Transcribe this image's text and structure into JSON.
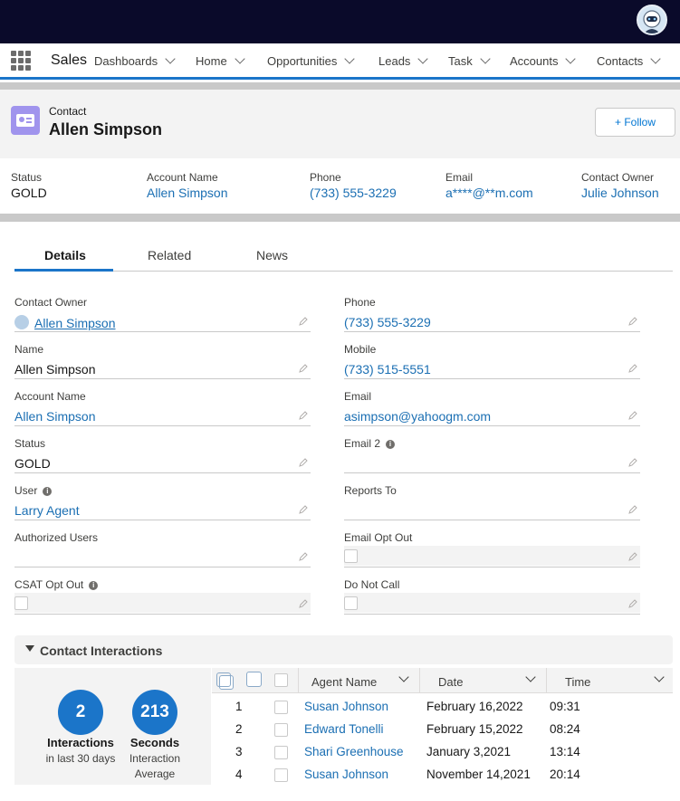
{
  "app": {
    "name": "Sales"
  },
  "nav": {
    "items": [
      {
        "label": "Dashboards"
      },
      {
        "label": "Home"
      },
      {
        "label": "Opportunities"
      },
      {
        "label": "Leads"
      },
      {
        "label": "Task"
      },
      {
        "label": "Accounts"
      },
      {
        "label": "Contacts"
      }
    ]
  },
  "record": {
    "object_label": "Contact",
    "name": "Allen Simpson",
    "follow_label": "+ Follow"
  },
  "highlights": [
    {
      "label": "Status",
      "value": "GOLD"
    },
    {
      "label": "Account Name",
      "value": "Allen Simpson"
    },
    {
      "label": "Phone",
      "value": "(733) 555-3229"
    },
    {
      "label": "Email",
      "value": "a****@**m.com"
    },
    {
      "label": "Contact Owner",
      "value": "Julie Johnson"
    }
  ],
  "tabs": [
    {
      "label": "Details"
    },
    {
      "label": "Related"
    },
    {
      "label": "News"
    }
  ],
  "fields": {
    "contact_owner": {
      "label": "Contact Owner",
      "value": "Allen Simpson"
    },
    "phone": {
      "label": "Phone",
      "value": "(733) 555-3229"
    },
    "name": {
      "label": "Name",
      "value": "Allen Simpson"
    },
    "mobile": {
      "label": "Mobile",
      "value": "(733) 515-5551"
    },
    "account_name": {
      "label": "Account Name",
      "value": "Allen Simpson"
    },
    "email": {
      "label": "Email",
      "value": "asimpson@yahoogm.com"
    },
    "status": {
      "label": "Status",
      "value": "GOLD"
    },
    "email2": {
      "label": "Email 2",
      "value": ""
    },
    "user": {
      "label": "User",
      "value": "Larry Agent"
    },
    "reports_to": {
      "label": "Reports To",
      "value": ""
    },
    "authorized_users": {
      "label": "Authorized Users",
      "value": ""
    },
    "email_opt_out": {
      "label": "Email Opt Out"
    },
    "csat_opt_out": {
      "label": "CSAT Opt Out"
    },
    "do_not_call": {
      "label": "Do Not Call"
    }
  },
  "interactions": {
    "title": "Contact Interactions",
    "stats": {
      "count": "2",
      "count_label": "Interactions",
      "count_sub": "in last 30 days",
      "seconds": "213",
      "seconds_label": "Seconds",
      "seconds_sub1": "Interaction",
      "seconds_sub2": "Average"
    },
    "columns": {
      "agent": "Agent Name",
      "date": "Date",
      "time": "Time"
    },
    "rows": [
      {
        "num": "1",
        "agent": "Susan Johnson",
        "date": "February 16,2022",
        "time": "09:31"
      },
      {
        "num": "2",
        "agent": "Edward Tonelli",
        "date": "February 15,2022",
        "time": "08:24"
      },
      {
        "num": "3",
        "agent": "Shari Greenhouse",
        "date": "January 3,2021",
        "time": "13:14"
      },
      {
        "num": "4",
        "agent": "Susan Johnson",
        "date": "November 14,2021",
        "time": "20:14"
      }
    ]
  }
}
